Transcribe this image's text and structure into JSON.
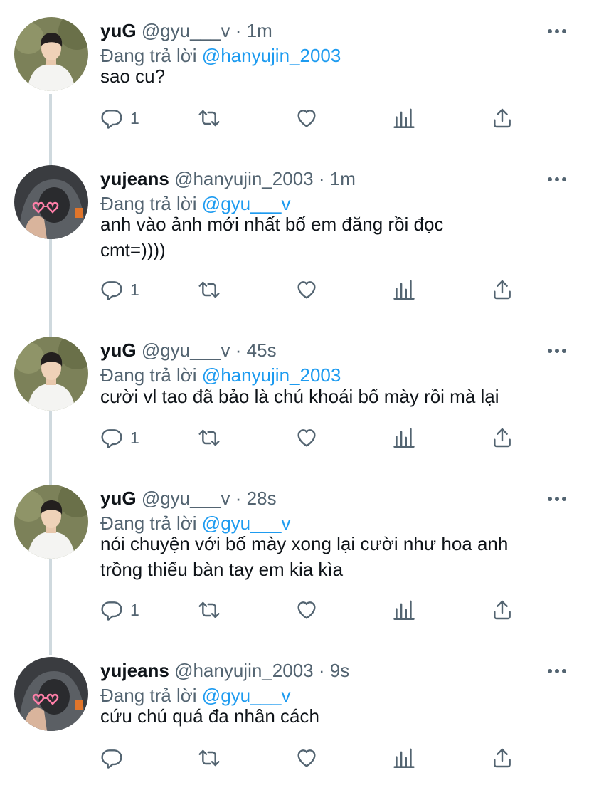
{
  "tweets": [
    {
      "name": "yuG",
      "handle": "@gyu___v",
      "sep": "·",
      "time": "1m",
      "reply_prefix": "Đang trả lời",
      "reply_to": "@hanyujin_2003",
      "lines": [
        "sao cu?"
      ],
      "reply_count": "1",
      "avatar": "yug"
    },
    {
      "name": "yujeans",
      "handle": "@hanyujin_2003",
      "sep": "·",
      "time": "1m",
      "reply_prefix": "Đang trả lời",
      "reply_to": "@gyu___v",
      "lines": [
        "anh vào ảnh mới nhất bố em đăng rồi đọc",
        "cmt=))))"
      ],
      "reply_count": "1",
      "avatar": "yujeans"
    },
    {
      "name": "yuG",
      "handle": "@gyu___v",
      "sep": "·",
      "time": "45s",
      "reply_prefix": "Đang trả lời",
      "reply_to": "@hanyujin_2003",
      "lines": [
        "cười vl tao đã bảo là chú khoái bố mày rồi mà lại"
      ],
      "reply_count": "1",
      "avatar": "yug"
    },
    {
      "name": "yuG",
      "handle": "@gyu___v",
      "sep": "·",
      "time": "28s",
      "reply_prefix": "Đang trả lời",
      "reply_to": "@gyu___v",
      "lines": [
        "nói chuyện với bố mày xong lại cười như hoa anh",
        "trồng thiếu bàn tay em kia kìa"
      ],
      "reply_count": "1",
      "avatar": "yug"
    },
    {
      "name": "yujeans",
      "handle": "@hanyujin_2003",
      "sep": "·",
      "time": "9s",
      "reply_prefix": "Đang trả lời",
      "reply_to": "@gyu___v",
      "lines": [
        "cứu chú quá đa nhân cách"
      ],
      "reply_count": "",
      "avatar": "yujeans"
    }
  ],
  "icons": {
    "reply": "reply-icon",
    "retweet": "retweet-icon",
    "like": "heart-icon",
    "analytics": "analytics-icon",
    "share": "share-icon",
    "more": "more-icon"
  },
  "colors": {
    "mention": "#1d9bf0",
    "secondary": "#536471",
    "thread_line": "#cfd9de"
  }
}
